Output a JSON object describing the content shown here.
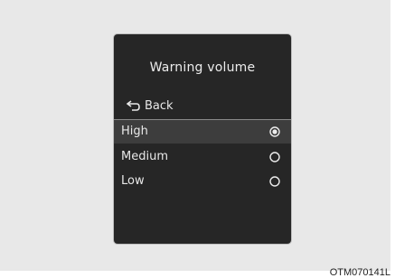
{
  "menu": {
    "title": "Warning volume",
    "back_label": "Back",
    "options": [
      {
        "label": "High",
        "selected": true
      },
      {
        "label": "Medium",
        "selected": false
      },
      {
        "label": "Low",
        "selected": false
      }
    ]
  },
  "caption": "OTM070141L",
  "colors": {
    "screen_bg": "#262626",
    "highlight_row": "#3d3d3d",
    "text": "#e8e8e8"
  }
}
